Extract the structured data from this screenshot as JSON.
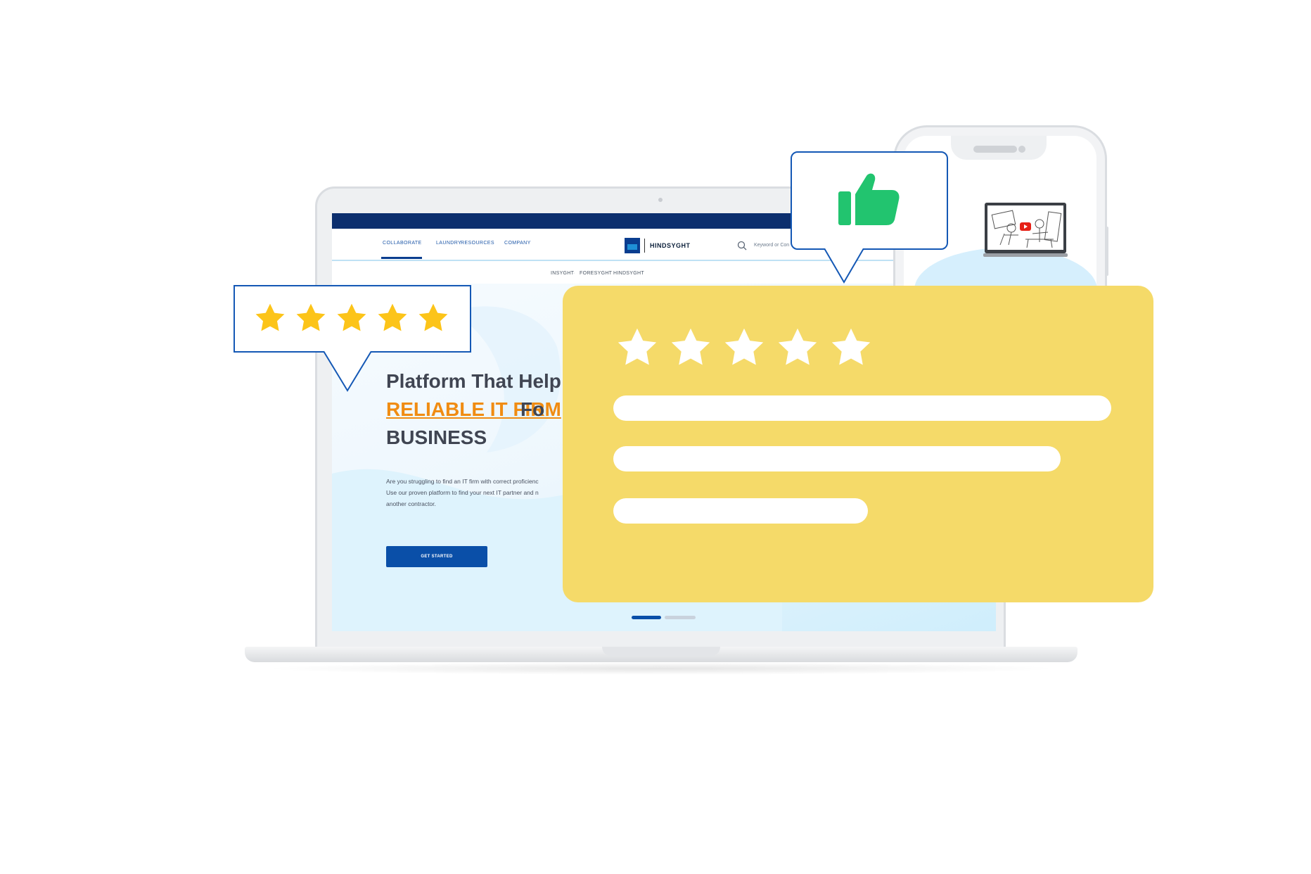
{
  "screen": {
    "nav": {
      "links": [
        "COLLABORATE",
        "LAUNDRY",
        "RESOURCES",
        "COMPANY"
      ],
      "brand": "HINDSYGHT",
      "search_placeholder": "Keyword or Con"
    },
    "breadcrumbs": [
      "INSYGHT",
      "FORESYGHT",
      "HINDSYGHT"
    ],
    "hero": {
      "line1": "Platform That Help",
      "highlight": "RELIABLE IT FIRM",
      "after_highlight": "Fo",
      "line3": "BUSINESS",
      "paragraph": [
        "Are you struggling to find an IT firm with correct proficienc",
        "Use our proven platform to find your next IT partner and n",
        "another contractor."
      ],
      "cta_label": "GET STARTED"
    },
    "carousel": {
      "active_index": 0,
      "count": 2
    }
  },
  "rating_bubble": {
    "stars": 5
  },
  "review_card": {
    "stars": 5
  },
  "colors": {
    "navy": "#0c2f6e",
    "brand_blue": "#0a4fa8",
    "bubble_border": "#1458b5",
    "star_gold": "#fcc419",
    "highlight_orange": "#f08c12",
    "card_yellow": "#f5da69",
    "thumb_green": "#22c46f"
  },
  "icons": [
    "star-icon",
    "thumbs-up-icon",
    "search-icon",
    "play-icon"
  ]
}
